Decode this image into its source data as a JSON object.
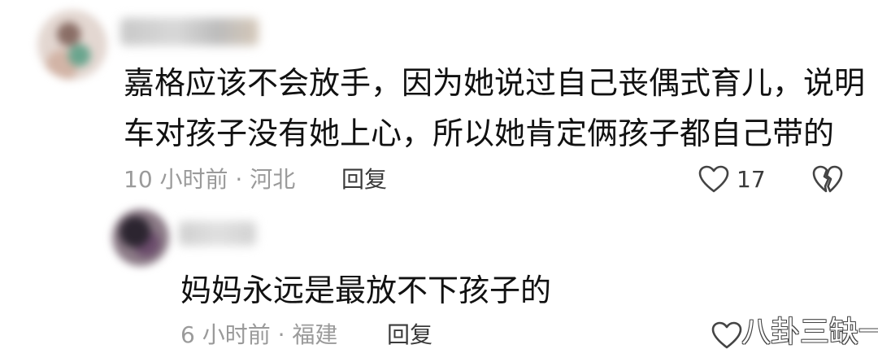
{
  "comments": [
    {
      "text_lines": [
        "嘉格应该不会放手，因为她说过自己丧偶式育儿，说明",
        "车对孩子没有她上心，所以她肯定俩孩子都自己带的"
      ],
      "meta": "10 小时前 · 河北",
      "reply_label": "回复",
      "like_count": "17"
    },
    {
      "text_lines": [
        "妈妈永远是最放不下孩子的"
      ],
      "meta": "6 小时前 · 福建",
      "reply_label": "回复"
    }
  ],
  "icons": {
    "like": "heart-outline-icon",
    "dislike": "broken-heart-icon"
  },
  "watermark": "八卦三缺一",
  "colors": {
    "text": "#111111",
    "meta": "#9a9a9a",
    "icon": "#444444"
  }
}
